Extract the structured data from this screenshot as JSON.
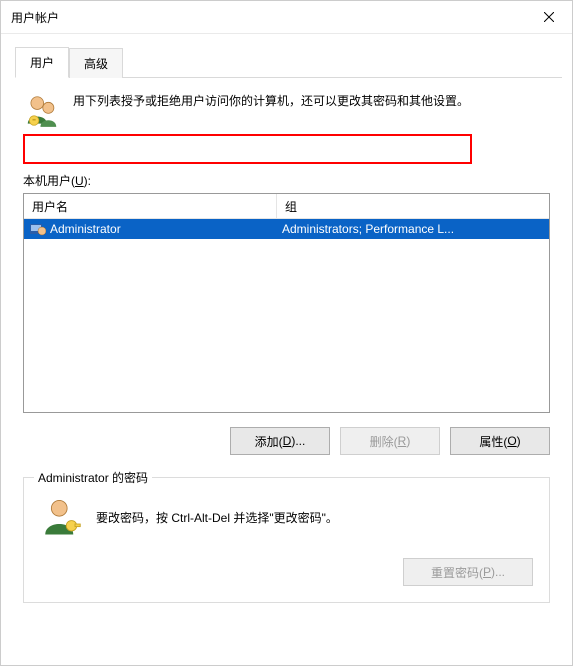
{
  "window": {
    "title": "用户帐户"
  },
  "tabs": {
    "user": "用户",
    "advanced": "高级"
  },
  "intro": {
    "text": "用下列表授予或拒绝用户访问你的计算机，还可以更改其密码和其他设置。"
  },
  "list": {
    "label_prefix": "本机用户(",
    "label_key": "U",
    "label_suffix": "):",
    "columns": {
      "name": "用户名",
      "group": "组"
    },
    "rows": [
      {
        "name": "Administrator",
        "group": "Administrators; Performance L..."
      }
    ]
  },
  "buttons": {
    "add_prefix": "添加(",
    "add_key": "D",
    "add_suffix": ")...",
    "remove_prefix": "删除(",
    "remove_key": "R",
    "remove_suffix": ")",
    "props_prefix": "属性(",
    "props_key": "O",
    "props_suffix": ")"
  },
  "password_box": {
    "legend": "Administrator 的密码",
    "text": "要改密码，按 Ctrl-Alt-Del 并选择\"更改密码\"。",
    "reset_prefix": "重置密码(",
    "reset_key": "P",
    "reset_suffix": ")..."
  }
}
